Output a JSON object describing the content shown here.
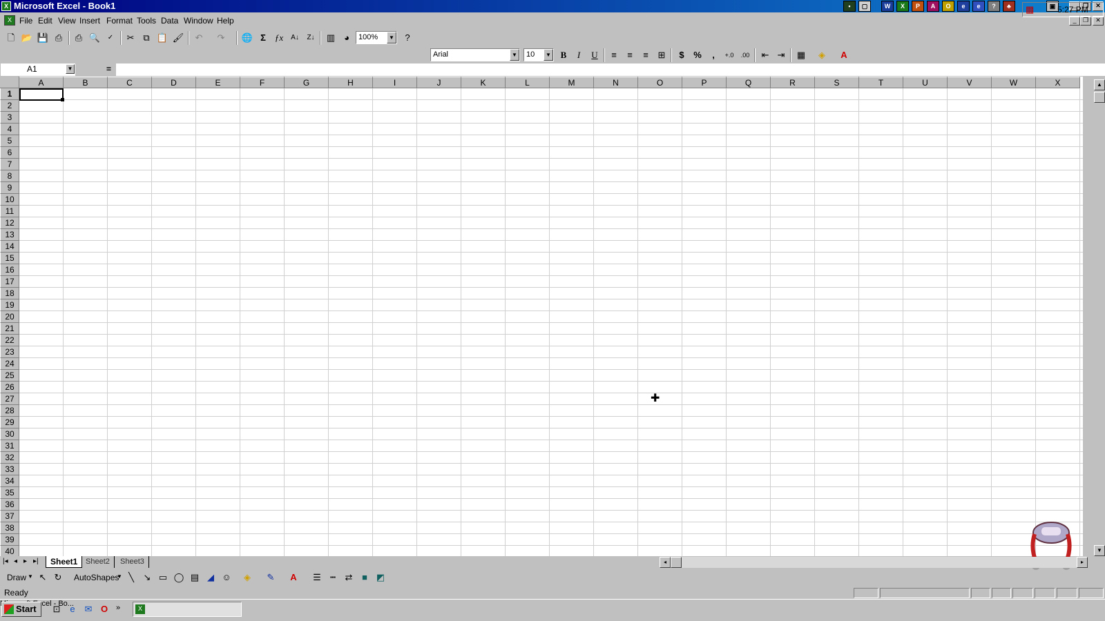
{
  "window": {
    "title": "Microsoft Excel - Book1"
  },
  "menu": [
    "File",
    "Edit",
    "View",
    "Insert",
    "Format",
    "Tools",
    "Data",
    "Window",
    "Help"
  ],
  "standard_toolbar": {
    "zoom": "100%"
  },
  "formatting_toolbar": {
    "font": "Arial",
    "size": "10"
  },
  "formula_bar": {
    "name_box": "A1",
    "equals": "="
  },
  "grid": {
    "columns": [
      "A",
      "B",
      "C",
      "D",
      "E",
      "F",
      "G",
      "H",
      "I",
      "J",
      "K",
      "L",
      "M",
      "N",
      "O",
      "P",
      "Q",
      "R",
      "S",
      "T",
      "U",
      "V",
      "W",
      "X"
    ],
    "rows": [
      "1",
      "2",
      "3",
      "4",
      "5",
      "6",
      "7",
      "8",
      "9",
      "10",
      "11",
      "12",
      "13",
      "14",
      "15",
      "16",
      "17",
      "18",
      "19",
      "20",
      "21",
      "22",
      "23",
      "24",
      "25",
      "26",
      "27",
      "28",
      "29",
      "30",
      "31",
      "32",
      "33",
      "34",
      "35",
      "36",
      "37",
      "38",
      "39",
      "40"
    ],
    "active_cell": "A1"
  },
  "sheets": [
    "Sheet1",
    "Sheet2",
    "Sheet3"
  ],
  "drawing_toolbar": {
    "draw_label": "Draw",
    "autoshapes_label": "AutoShapes"
  },
  "status": {
    "text": "Ready"
  },
  "taskbar": {
    "start_label": "Start",
    "task_label": "Microsoft Excel - Bo...",
    "clock": "5:27 PM"
  },
  "colors": {
    "title_start": "#000080",
    "title_end": "#1084d0",
    "face": "#c0c0c0"
  }
}
